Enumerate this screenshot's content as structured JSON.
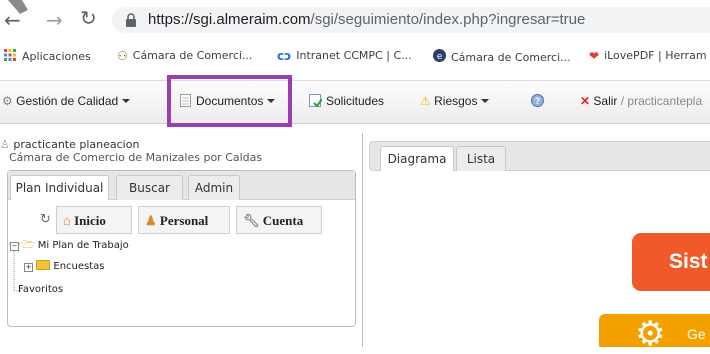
{
  "browser": {
    "url_host": "https://sgi.almeraim.com",
    "url_path": "/sgi/seguimiento/index.php?ingresar=true",
    "bookmarks": [
      {
        "label": "Aplicaciones",
        "icon": "apps-grid-icon"
      },
      {
        "label": "Cámara de Comerci...",
        "icon": "ccm-logo-icon"
      },
      {
        "label": "Intranet CCMPC | C...",
        "icon": "intranet-link-icon"
      },
      {
        "label": "Cámara de Comerci...",
        "icon": "e-logo-icon"
      },
      {
        "label": "iLovePDF | Herram",
        "icon": "heart-icon"
      }
    ]
  },
  "menu": {
    "gestion": "Gestión de Calidad",
    "documentos": "Documentos",
    "solicitudes": "Solicitudes",
    "riesgos": "Riesgos",
    "salir": "Salir",
    "salir_user": "/ practicantepla"
  },
  "user": {
    "name": "practicante planeacion",
    "org": "Cámara de Comercio de Manizales por Caldas"
  },
  "left_tabs": [
    "Plan Individual",
    "Buscar",
    "Admin"
  ],
  "toolbar": {
    "inicio": "Inicio",
    "personal": "Personal",
    "cuenta": "Cuenta"
  },
  "tree": {
    "root": "Mi Plan de Trabajo",
    "child": "Encuestas",
    "favoritos": "Favoritos"
  },
  "right_tabs": [
    "Diagrama",
    "Lista"
  ],
  "diagram": {
    "banner1": "Sist",
    "banner2": "Ge"
  },
  "colors": {
    "highlight": "#9b3db6",
    "orange": "#ef5a28",
    "orange2": "#f4a100"
  }
}
